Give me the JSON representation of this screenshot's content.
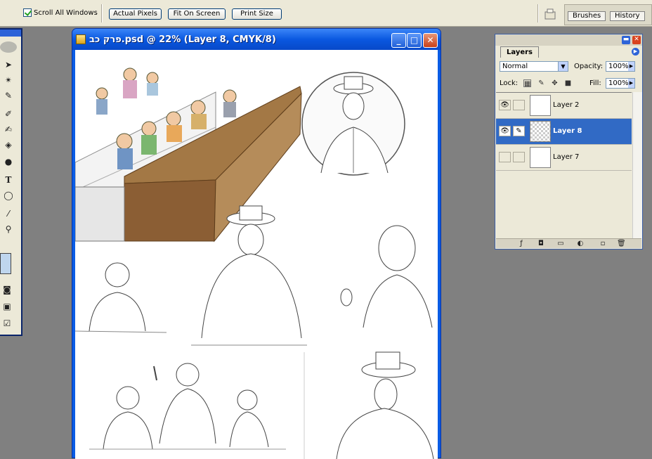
{
  "options_bar": {
    "scroll_all_windows": "Scroll All Windows",
    "actual_pixels": "Actual Pixels",
    "fit_on_screen": "Fit On Screen",
    "print_size": "Print Size"
  },
  "palette_well": {
    "tabs": [
      "Brushes",
      "History"
    ]
  },
  "document": {
    "title": "פרק כב.psd @ 22% (Layer 8, CMYK/8)",
    "buttons": {
      "minimize": "_",
      "maximize": "□",
      "close": "✕"
    }
  },
  "layers_panel": {
    "tab": "Layers",
    "blend_mode": "Normal",
    "opacity_label": "Opacity:",
    "opacity": "100%",
    "lock_label": "Lock:",
    "fill_label": "Fill:",
    "fill": "100%",
    "layers": [
      {
        "name": "Layer 2",
        "visible": true,
        "selected": false
      },
      {
        "name": "Layer 8",
        "visible": true,
        "selected": true
      },
      {
        "name": "Layer 7",
        "visible": false,
        "selected": false
      }
    ]
  },
  "colors": {
    "xp_blue": "#0a5ce5",
    "selection": "#316ac5",
    "panel_bg": "#ece9d8",
    "desk_brown": "#9a6a3a"
  }
}
